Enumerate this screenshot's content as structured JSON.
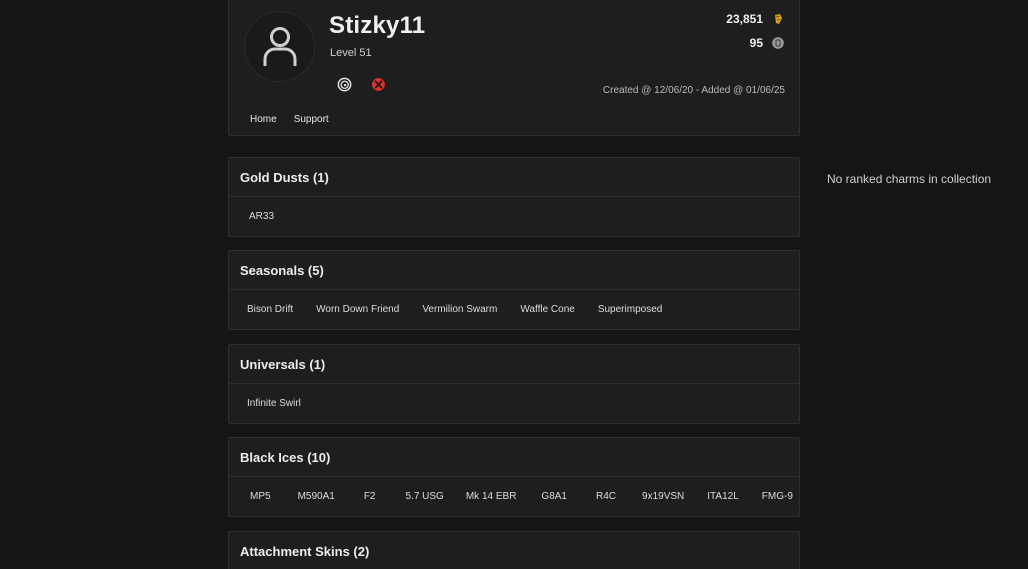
{
  "profile": {
    "username": "Stizky11",
    "level": "Level 51",
    "credits": "23,851",
    "renown": "95",
    "created": "Created @ 12/06/20 - Added @ 01/06/25",
    "platforms": [
      "ubisoft-icon",
      "xbox-icon"
    ],
    "nav": [
      "Home",
      "Support"
    ]
  },
  "sections": {
    "gold_dusts": {
      "title": "Gold Dusts (1)",
      "items": [
        "AR33"
      ]
    },
    "seasonals": {
      "title": "Seasonals (5)",
      "items": [
        "Bison Drift",
        "Worn Down Friend",
        "Vermilion Swarm",
        "Waffle Cone",
        "Superimposed"
      ]
    },
    "universals": {
      "title": "Universals (1)",
      "items": [
        "Infinite Swirl"
      ]
    },
    "black_ices": {
      "title": "Black Ices (10)",
      "items": [
        "MP5",
        "M590A1",
        "F2",
        "5.7 USG",
        "Mk 14 EBR",
        "G8A1",
        "R4C",
        "9x19VSN",
        "ITA12L",
        "FMG-9"
      ]
    },
    "attachment_skins": {
      "title": "Attachment Skins (2)"
    }
  },
  "sidebar": {
    "no_ranked": "No ranked charms in collection"
  },
  "colors": {
    "background": "#151515",
    "card": "#1e1e1e",
    "border": "#2e2e2e",
    "xbox": "#e0322f",
    "gold": "#d7a51c"
  }
}
